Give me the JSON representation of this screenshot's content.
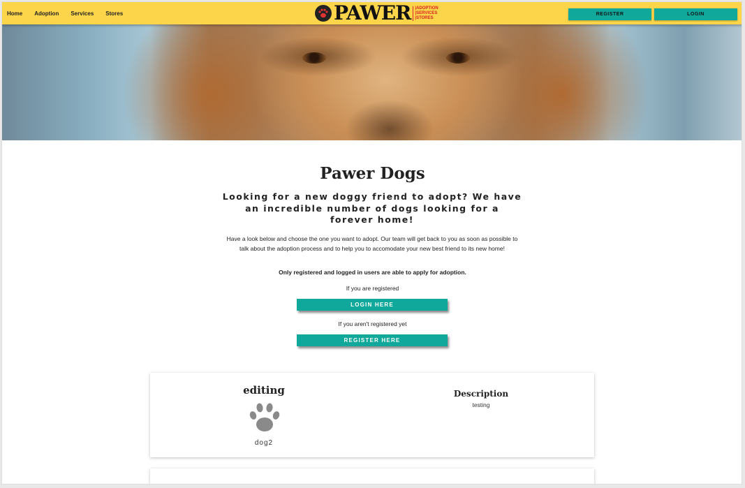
{
  "nav": {
    "items": [
      "Home",
      "Adoption",
      "Services",
      "Stores"
    ],
    "logo_word": "PAWER",
    "logo_sub": [
      "|ADOPTION",
      "|SERVICES",
      "|STORES"
    ],
    "register_label": "REGISTER",
    "login_label": "LOGIN"
  },
  "main": {
    "title": "Pawer Dogs",
    "subheading": "Looking for a new doggy friend to adopt? We have an incredible number of dogs looking for a forever home!",
    "paragraph": "Have a look below and choose the one you want to adopt. Our team will get back to you as soon as possible to talk about the adoption process and to help you to accomodate your new best friend to its new home!",
    "notice": "Only registered and logged in users are able to apply for adoption.",
    "registered_prompt": "If you are registered",
    "login_cta": "LOGIN HERE",
    "unregistered_prompt": "If you aren't registered yet",
    "register_cta": "REGISTER HERE"
  },
  "cards": [
    {
      "name": "editing",
      "breed": "dog2",
      "description_label": "Description",
      "description": "testing"
    }
  ],
  "colors": {
    "topbar": "#fcd54b",
    "accent": "#10a89a",
    "logo_red": "#d22222"
  },
  "icons": {
    "card_icon": "paw-icon",
    "logo_icon": "paw-icon"
  }
}
